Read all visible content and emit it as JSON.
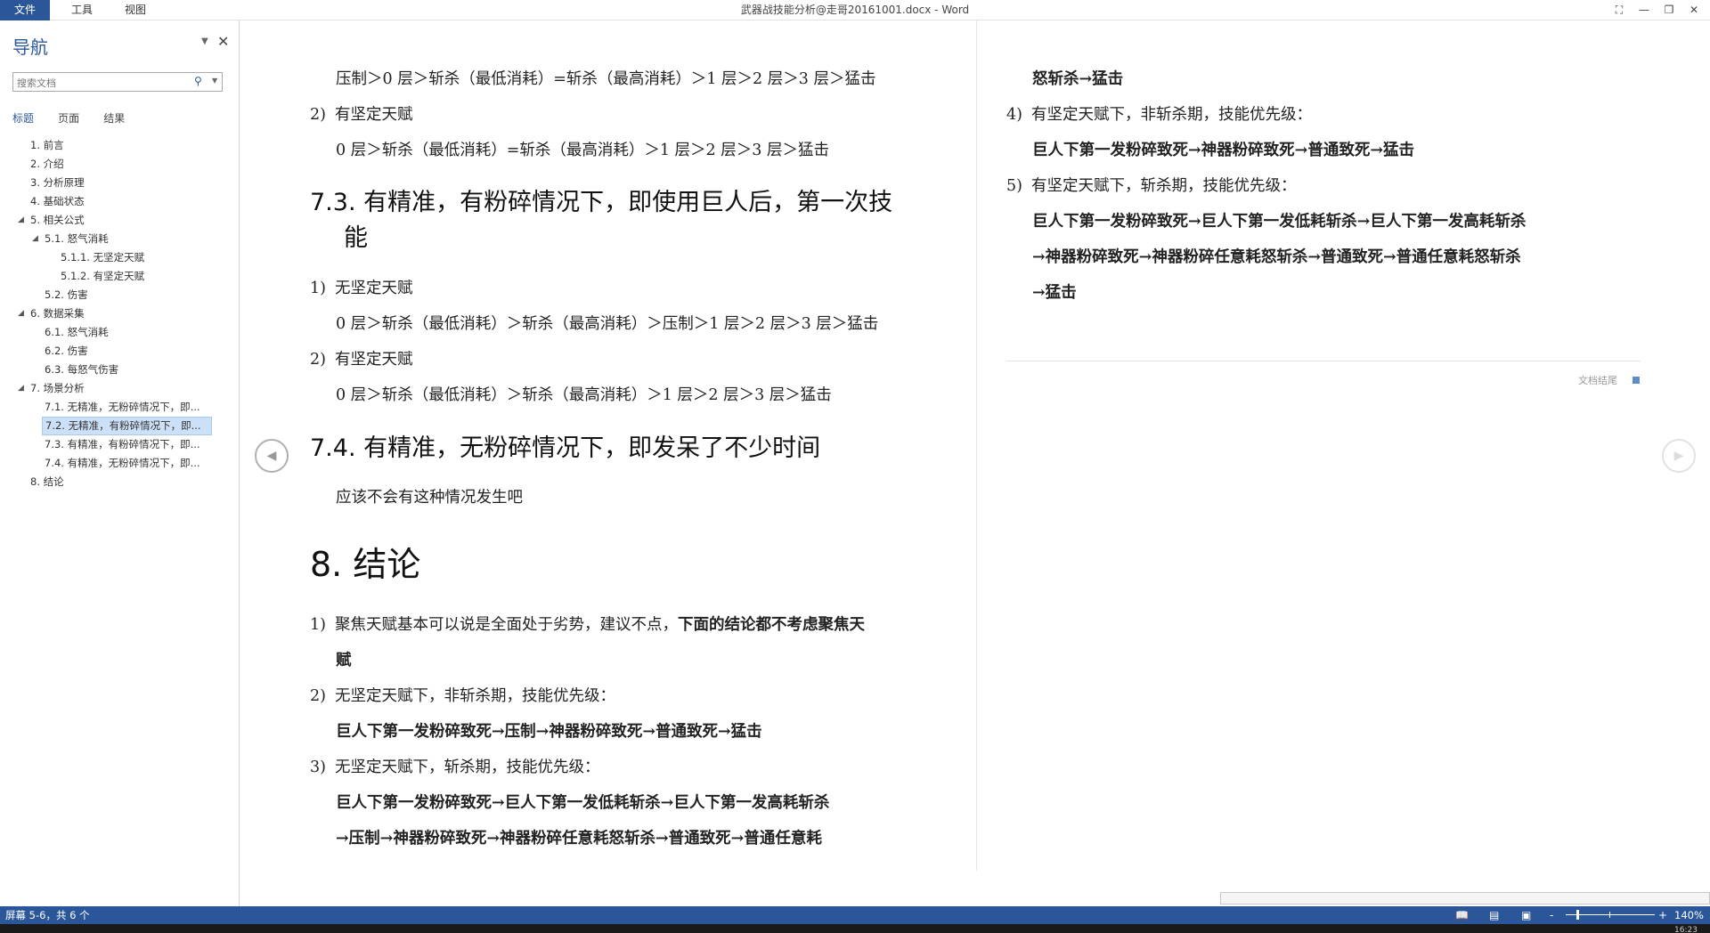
{
  "titlebar": {
    "tabs": [
      "文件",
      "工具",
      "视图"
    ],
    "title": "武器战技能分析@走哥20161001.docx - Word",
    "restore_icon": "restore-down-icon",
    "minimize_icon": "minimize-icon",
    "close_icon": "close-icon"
  },
  "nav": {
    "title": "导航",
    "search_placeholder": "搜索文档",
    "tabs": [
      "标题",
      "页面",
      "结果"
    ],
    "items": [
      {
        "label": "1. 前言",
        "level": 0,
        "caret": false
      },
      {
        "label": "2. 介绍",
        "level": 0,
        "caret": false
      },
      {
        "label": "3. 分析原理",
        "level": 0,
        "caret": false
      },
      {
        "label": "4. 基础状态",
        "level": 0,
        "caret": false
      },
      {
        "label": "5. 相关公式",
        "level": 0,
        "caret": true
      },
      {
        "label": "5.1. 怒气消耗",
        "level": 1,
        "caret": true
      },
      {
        "label": "5.1.1. 无坚定天赋",
        "level": 2,
        "caret": false
      },
      {
        "label": "5.1.2. 有坚定天赋",
        "level": 2,
        "caret": false
      },
      {
        "label": "5.2. 伤害",
        "level": 1,
        "caret": false
      },
      {
        "label": "6. 数据采集",
        "level": 0,
        "caret": true
      },
      {
        "label": "6.1. 怒气消耗",
        "level": 1,
        "caret": false
      },
      {
        "label": "6.2. 伤害",
        "level": 1,
        "caret": false
      },
      {
        "label": "6.3. 每怒气伤害",
        "level": 1,
        "caret": false
      },
      {
        "label": "7. 场景分析",
        "level": 0,
        "caret": true
      },
      {
        "label": "7.1. 无精准，无粉碎情况下，即...",
        "level": 1,
        "caret": false
      },
      {
        "label": "7.2. 无精准，有粉碎情况下，即...",
        "level": 1,
        "caret": false,
        "selected": true
      },
      {
        "label": "7.3. 有精准，有粉碎情况下，即...",
        "level": 1,
        "caret": false
      },
      {
        "label": "7.4. 有精准，无粉碎情况下，即...",
        "level": 1,
        "caret": false
      },
      {
        "label": "8. 结论",
        "level": 0,
        "caret": false
      }
    ]
  },
  "doc": {
    "col1": {
      "line_top": "压制＞0 层＞斩杀（最低消耗）=斩杀（最高消耗）＞1 层＞2 层＞3 层＞猛击",
      "item_a_num": "2)",
      "item_a": "有坚定天赋",
      "item_a_detail": "0 层＞斩杀（最低消耗）=斩杀（最高消耗）＞1 层＞2 层＞3 层＞猛击",
      "h73_line1": "7.3. 有精准，有粉碎情况下，即使用巨人后，第一次技",
      "h73_line2": "能",
      "i1_num": "1)",
      "i1": "无坚定天赋",
      "i1_detail": "0 层＞斩杀（最低消耗）＞斩杀（最高消耗）＞压制＞1 层＞2 层＞3 层＞猛击",
      "i2_num": "2)",
      "i2": "有坚定天赋",
      "i2_detail": "0 层＞斩杀（最低消耗）＞斩杀（最高消耗）＞1 层＞2 层＞3 层＞猛击",
      "h74": "7.4. 有精准，无粉碎情况下，即发呆了不少时间",
      "h74_text": "应该不会有这种情况发生吧",
      "h8": "8.  结论",
      "c1_num": "1)",
      "c1_normal": "聚焦天赋基本可以说是全面处于劣势，建议不点，",
      "c1_bold": "下面的结论都不考虑聚焦天",
      "c1_bold2": "赋",
      "c2_num": "2)",
      "c2": "无坚定天赋下，非斩杀期，技能优先级：",
      "c2_detail": "巨人下第一发粉碎致死→压制→神器粉碎致死→普通致死→猛击",
      "c3_num": "3)",
      "c3": "无坚定天赋下，斩杀期，技能优先级：",
      "c3_detail1": "巨人下第一发粉碎致死→巨人下第一发低耗斩杀→巨人下第一发高耗斩杀",
      "c3_detail2": "→压制→神器粉碎致死→神器粉碎任意耗怒斩杀→普通致死→普通任意耗"
    },
    "col2": {
      "line_top": "怒斩杀→猛击",
      "c4_num": "4)",
      "c4": "有坚定天赋下，非斩杀期，技能优先级：",
      "c4_detail": "巨人下第一发粉碎致死→神器粉碎致死→普通致死→猛击",
      "c5_num": "5)",
      "c5": "有坚定天赋下，斩杀期，技能优先级：",
      "c5_detail1": "巨人下第一发粉碎致死→巨人下第一发低耗斩杀→巨人下第一发高耗斩杀",
      "c5_detail2": "→神器粉碎致死→神器粉碎任意耗怒斩杀→普通致死→普通任意耗怒斩杀",
      "c5_detail3": "→猛击",
      "end_label": "文档结尾"
    }
  },
  "status": {
    "screen_info": "屏幕 5-6，共 6 个",
    "zoom": "140%",
    "zoom_minus": "-",
    "zoom_plus": "+",
    "clock": "16:23"
  }
}
